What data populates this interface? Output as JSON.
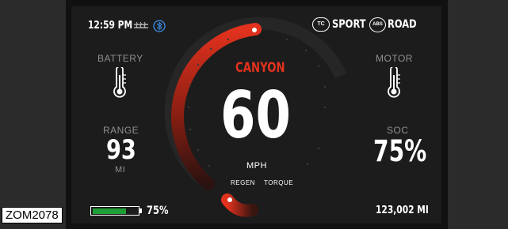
{
  "caption": "ZOM2078",
  "status_bar": {
    "time": "12:59 PM",
    "traction_badge": "TC",
    "mode": "SPORT",
    "abs_badge": "ABS",
    "surface": "ROAD"
  },
  "left_panel": {
    "battery_label": "BATTERY",
    "range_label": "RANGE",
    "range_value": "93",
    "range_unit": "MI",
    "battery_percent": "75%",
    "battery_level": 0.75
  },
  "right_panel": {
    "motor_label": "MOTOR",
    "soc_label": "SOC",
    "soc_value": "75%",
    "odometer": "123,002 MI"
  },
  "center": {
    "ride_mode": "CANYON",
    "speed": "60",
    "speed_unit": "MPH",
    "regen_label": "REGEN",
    "torque_label": "TORQUE"
  },
  "colors": {
    "accent": "#e2321e",
    "battery_fill": "#1e9e36",
    "bluetooth": "#3a8ee6"
  }
}
